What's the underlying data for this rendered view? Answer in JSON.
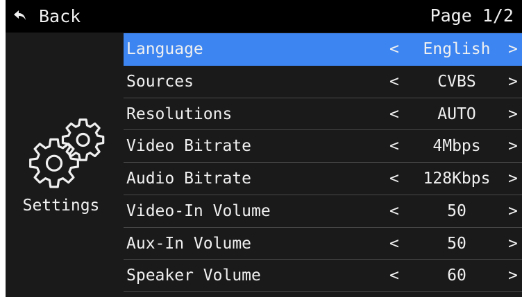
{
  "header": {
    "back_label": "Back",
    "page_label": "Page 1/2"
  },
  "sidebar": {
    "icon": "gears-icon",
    "label": "Settings"
  },
  "settings": [
    {
      "label": "Language",
      "value": "English",
      "selected": true
    },
    {
      "label": "Sources",
      "value": "CVBS"
    },
    {
      "label": "Resolutions",
      "value": "AUTO"
    },
    {
      "label": "Video Bitrate",
      "value": "4Mbps"
    },
    {
      "label": "Audio Bitrate",
      "value": "128Kbps"
    },
    {
      "label": "Video-In Volume",
      "value": "50"
    },
    {
      "label": "Aux-In Volume",
      "value": "50"
    },
    {
      "label": "Speaker Volume",
      "value": "60"
    }
  ],
  "arrows": {
    "prev": "<",
    "next": ">"
  },
  "colors": {
    "highlight": "#3d86f2",
    "background": "#1a1a1a",
    "header": "#000000",
    "text": "#f0f0f0"
  }
}
